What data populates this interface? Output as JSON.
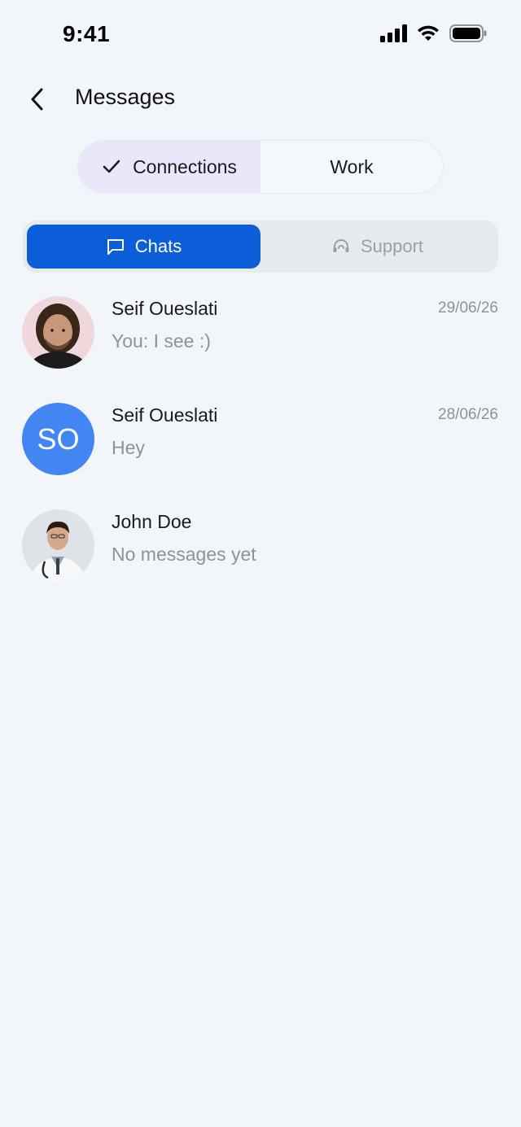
{
  "status_bar": {
    "time": "9:41"
  },
  "header": {
    "title": "Messages"
  },
  "segments": [
    {
      "label": "Connections",
      "active": true
    },
    {
      "label": "Work",
      "active": false
    }
  ],
  "tabs": [
    {
      "label": "Chats",
      "icon": "chat-bubble-icon",
      "active": true
    },
    {
      "label": "Support",
      "icon": "headset-icon",
      "active": false
    }
  ],
  "chats": [
    {
      "name": "Seif Oueslati",
      "preview": "You: I see :)",
      "date": "29/06/26",
      "avatar": "photo"
    },
    {
      "name": "Seif Oueslati",
      "preview": "Hey",
      "date": "28/06/26",
      "avatar_initials": "SO"
    },
    {
      "name": "John Doe",
      "preview": "No messages yet",
      "date": "",
      "avatar": "photo"
    }
  ],
  "colors": {
    "background": "#f2f6fa",
    "accent": "#0c5ed8",
    "segment_active": "#e9e8fb",
    "avatar_initials_bg": "#4286f4"
  }
}
